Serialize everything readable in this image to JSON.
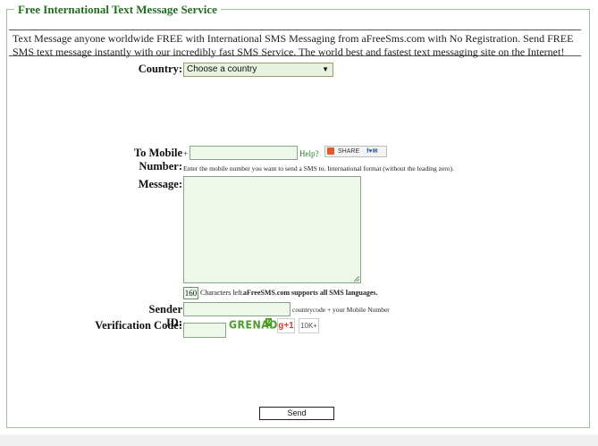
{
  "form": {
    "legend": "Free International Text Message Service",
    "intro": "Text Message anyone worldwide FREE with International SMS Messaging from aFreeSms.com with No Registration. Send FREE SMS text message instantly with our incredibly fast SMS Service. The world best and fastest text messaging site on the Internet!",
    "country_label": "Country:",
    "country_selected": "Choose a country",
    "mobile_label": "To Mobile Number:",
    "mobile_prefix": "+",
    "mobile_value": "",
    "help_link": "Help?",
    "share_label": "SHARE",
    "mobile_hint": "Enter the mobile number you want to send a SMS to. International format (without the leading zero).",
    "message_label": "Message:",
    "message_value": "",
    "chars_left_count": "160",
    "chars_left_text": "Characters left.",
    "languages_note": "aFreeSMS.com supports all SMS languages.",
    "sender_label": "Sender ID:",
    "sender_value": "",
    "sender_hint": "countrycode + your Mobile Number",
    "verification_label": "Verification Code:",
    "verification_value": "",
    "captcha_text": "GRENADE",
    "gplus_label": "g+1",
    "gplus_count": "10K+",
    "send_label": "Send"
  },
  "icons": {
    "dropdown": "chevron-down-icon",
    "share": "share-icon",
    "refresh": "refresh-icon"
  },
  "colors": {
    "legend_text": "#1f6e1f",
    "input_bg": "#eef8ea",
    "captcha": "#4c9a2a",
    "gplus": "#d73d32"
  }
}
